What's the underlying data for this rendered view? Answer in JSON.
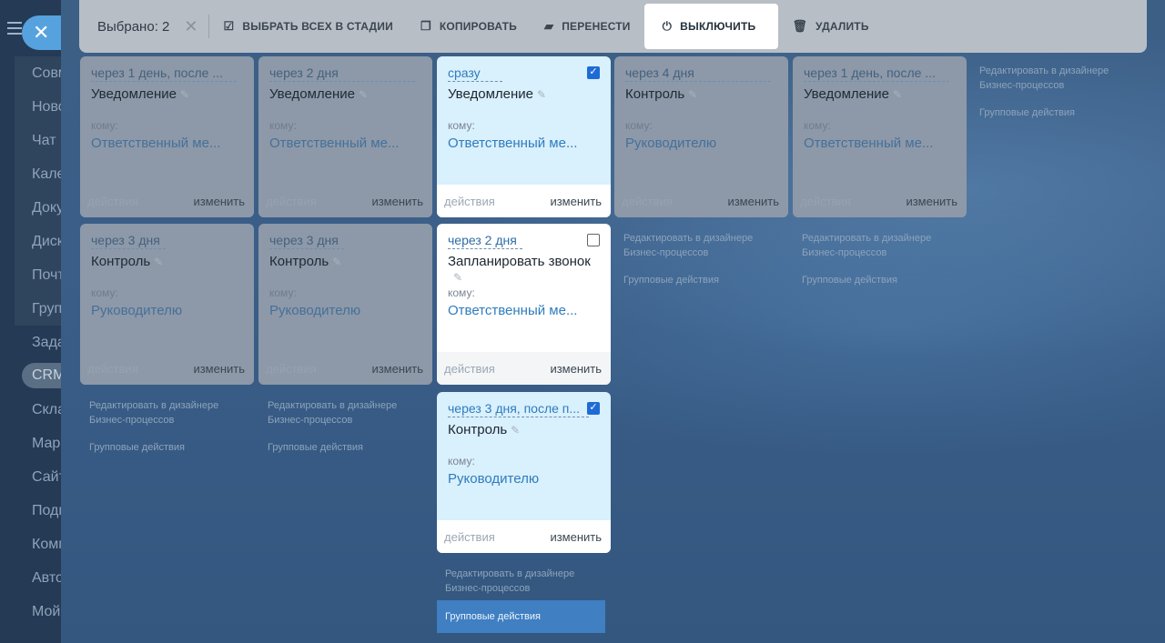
{
  "sidebar": {
    "items": [
      "Совм",
      "Ново",
      "Чат и",
      "Кале",
      "Доку",
      "Диск",
      "Почт",
      "Груп",
      "Зада",
      "CRM",
      "Скла",
      "Марк",
      "Сайт",
      "Подп",
      "Комп",
      "Авто",
      "Мой"
    ]
  },
  "toolbar": {
    "selected_label": "Выбрано: 2",
    "select_all_label": "ВЫБРАТЬ ВСЕХ В СТАДИИ",
    "copy_label": "КОПИРОВАТЬ",
    "move_label": "ПЕРЕНЕСТИ",
    "disable_label": "ВЫКЛЮЧИТЬ",
    "delete_label": "УДАЛИТЬ"
  },
  "common": {
    "komu": "кому:",
    "actions": "действия",
    "change": "изменить",
    "designer_link": "Редактировать в дизайнере Бизнес-процессов",
    "group_actions": "Групповые действия"
  },
  "cards": [
    {
      "delay": "через 1 день, после ...",
      "title": "Уведомление",
      "resp": "Ответственный ме..."
    },
    {
      "delay": "через 2 дня",
      "title": "Уведомление",
      "resp": "Ответственный ме..."
    },
    {
      "delay": "сразу",
      "title": "Уведомление",
      "resp": "Ответственный ме..."
    },
    {
      "delay": "через 4 дня",
      "title": "Контроль",
      "resp": "Руководителю"
    },
    {
      "delay": "через 1 день, после ...",
      "title": "Уведомление",
      "resp": "Ответственный ме..."
    },
    {
      "delay": "через 3 дня",
      "title": "Контроль",
      "resp": "Руководителю"
    },
    {
      "delay": "через 3 дня",
      "title": "Контроль",
      "resp": "Руководителю"
    },
    {
      "delay": "через 2 дня",
      "title": "Запланировать звонок",
      "resp": "Ответственный ме..."
    },
    {
      "delay": "через 3 дня, после п...",
      "title": "Контроль",
      "resp": "Руководителю"
    }
  ],
  "colors": {
    "accent": "#3f7fc2",
    "checkbox": "#1f6bd6",
    "selected_card": "#d9f0fd"
  }
}
